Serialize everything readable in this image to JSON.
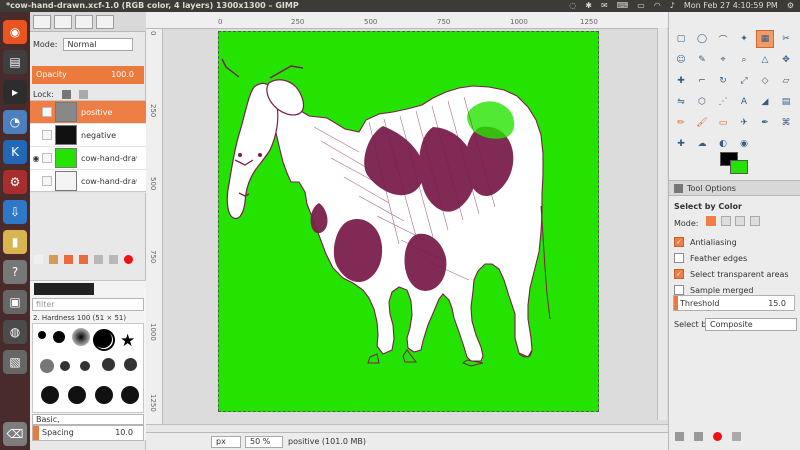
{
  "window": {
    "title": "*cow-hand-drawn.xcf-1.0 (RGB color, 4 layers) 1300x1300 – GIMP",
    "datetime": "Mon Feb 27 4:10:59 PM"
  },
  "left_panel": {
    "mode_label": "Mode:",
    "mode_value": "Normal",
    "opacity_label": "Opacity",
    "opacity_value": "100.0",
    "lock_label": "Lock:",
    "layers": [
      {
        "name": "positive",
        "visible": false,
        "selected": true
      },
      {
        "name": "negative",
        "visible": false,
        "selected": false
      },
      {
        "name": "cow-hand-drawn.",
        "visible": true,
        "selected": false
      },
      {
        "name": "cow-hand-drawn.",
        "visible": false,
        "selected": false
      }
    ],
    "filter_placeholder": "filter",
    "brush_label": "2. Hardness 100 (51 × 51)",
    "brush_preset": "Basic,",
    "spacing_label": "Spacing",
    "spacing_value": "10.0"
  },
  "canvas": {
    "ruler_top": [
      "0",
      "250",
      "500",
      "750",
      "1000",
      "1250"
    ],
    "ruler_left": [
      "0",
      "250",
      "500",
      "750",
      "1000",
      "1250"
    ],
    "unit": "px",
    "zoom": "50 %",
    "status": "positive (101.0 MB)"
  },
  "right_panel": {
    "tool_options_tab": "Tool Options",
    "tool_title": "Select by Color",
    "mode_label": "Mode:",
    "options": [
      {
        "label": "Antialiasing",
        "checked": true
      },
      {
        "label": "Feather edges",
        "checked": false
      },
      {
        "label": "Select transparent areas",
        "checked": true
      },
      {
        "label": "Sample merged",
        "checked": false
      }
    ],
    "threshold_label": "Threshold",
    "threshold_value": "15.0",
    "select_by_label": "Select by:",
    "select_by_value": "Composite"
  },
  "colors": {
    "canvas_green": "#25e300",
    "accent": "#ed7a3d",
    "launcher": "#4a2b2b"
  }
}
